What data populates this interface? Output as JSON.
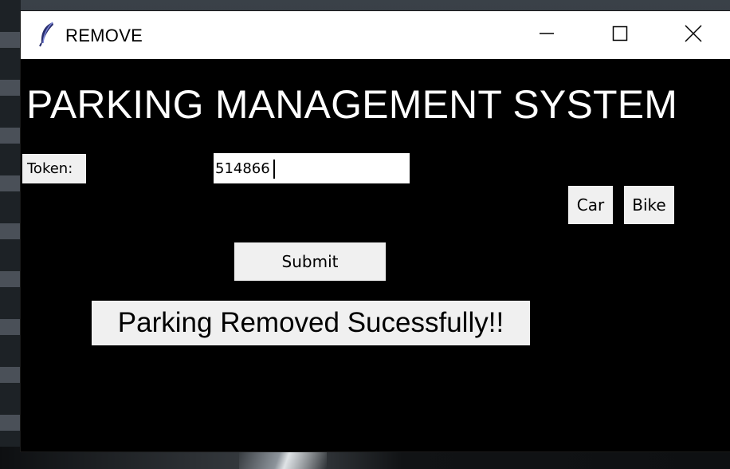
{
  "window": {
    "title": "REMOVE",
    "app_icon": "feather-icon",
    "controls": {
      "minimize_icon": "minimize-icon",
      "maximize_icon": "maximize-icon",
      "close_icon": "close-icon"
    }
  },
  "main": {
    "heading": "PARKING MANAGEMENT SYSTEM",
    "token_label": "Token:",
    "token_value": "514866",
    "car_label": "Car",
    "bike_label": "Bike",
    "submit_label": "Submit",
    "status_message": "Parking Removed Sucessfully!!"
  },
  "colors": {
    "window_background": "#000000",
    "titlebar_background": "#ffffff",
    "widget_background": "#f0f0f0",
    "heading_text": "#ffffff"
  }
}
